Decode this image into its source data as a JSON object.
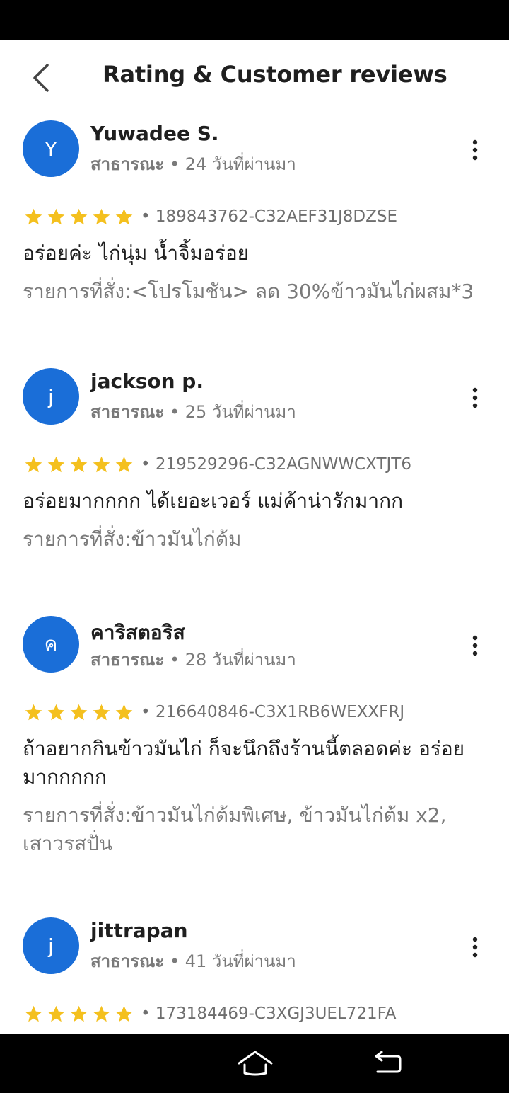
{
  "header": {
    "title": "Rating & Customer reviews",
    "back_icon": "chevron-left-icon"
  },
  "colors": {
    "avatar_bg": "#1a6ed8",
    "star": "#f4c01e",
    "muted_text": "#7a7a7a"
  },
  "reviews": [
    {
      "avatar_letter": "Y",
      "name": "Yuwadee S.",
      "visibility": "สาธารณะ",
      "time_ago": "24 วันที่ผ่านมา",
      "rating": 5,
      "order_id": "189843762-C32AEF31J8DZSE",
      "comment": "อร่อยค่ะ ไก่นุ่ม น้ำจิ้มอร่อย",
      "ordered": "รายการที่สั่ง:<โปรโมชัน> ลด 30%ข้าวมันไก่ผสม*3"
    },
    {
      "avatar_letter": "j",
      "name": "jackson p.",
      "visibility": "สาธารณะ",
      "time_ago": "25 วันที่ผ่านมา",
      "rating": 5,
      "order_id": "219529296-C32AGNWWCXTJT6",
      "comment": "อร่อยมากกกก ได้เยอะเวอร์ แม่ค้าน่ารักมากก",
      "ordered": "รายการที่สั่ง:ข้าวมันไก่ต้ม"
    },
    {
      "avatar_letter": "ค",
      "name": "คาริสตอริส",
      "visibility": "สาธารณะ",
      "time_ago": "28 วันที่ผ่านมา",
      "rating": 5,
      "order_id": "216640846-C3X1RB6WEXXFRJ",
      "comment": "ถ้าอยากกินข้าวมันไก่ ก็จะนึกถึงร้านนี้ตลอดค่ะ อร่อยมากกกกก",
      "ordered": "รายการที่สั่ง:ข้าวมันไก่ต้มพิเศษ, ข้าวมันไก่ต้ม x2, เสาวรสปั่น"
    },
    {
      "avatar_letter": "j",
      "name": "jittrapan",
      "visibility": "สาธารณะ",
      "time_ago": "41 วันที่ผ่านมา",
      "rating": 5,
      "order_id": "173184469-C3XGJ3UEL721FA",
      "comment": "",
      "ordered": ""
    }
  ],
  "nav": {
    "home_icon": "home-icon",
    "back_icon": "back-arrow-icon"
  }
}
